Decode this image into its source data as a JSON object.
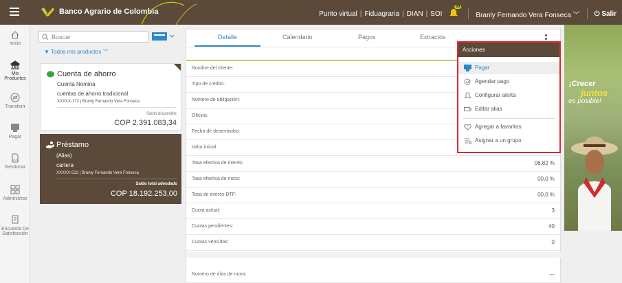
{
  "header": {
    "brand": "Banco Agrario de Colombia",
    "links": [
      "Punto virtual",
      "Fiduagraria",
      "DIAN",
      "SOI"
    ],
    "notification_count": "99",
    "user_name": "Branly Fernando Vera Fonseca",
    "logout_label": "Salir",
    "brand_color": "#5b4a3a"
  },
  "nav": [
    {
      "label": "Inicio",
      "icon": "home-icon"
    },
    {
      "label": "Mis Productos",
      "icon": "bank-icon"
    },
    {
      "label": "Transferir",
      "icon": "transfer-icon"
    },
    {
      "label": "Pagar",
      "icon": "pay-icon"
    },
    {
      "label": "Gestionar",
      "icon": "manage-icon"
    },
    {
      "label": "Administrar",
      "icon": "grid-icon"
    },
    {
      "label": "Encuesta De Satisfacción",
      "icon": "survey-icon"
    }
  ],
  "search": {
    "placeholder": "Buscar"
  },
  "filter_label": "Todos mis productos",
  "products": [
    {
      "title": "Cuenta de ahorro",
      "subtitle": "Cuenta Nomina",
      "description": "cuentas de ahorro tradicional",
      "detail": "XXXXX-172 | Branly Fernando Vera Fonseca",
      "balance_label": "Saldo disponible",
      "balance": "COP 2.391.083,34"
    },
    {
      "title": "Préstamo",
      "subtitle": "(Alias)",
      "description": "cartera",
      "detail": "XXXXX-512 | Branly Fernando Vera Fonseca",
      "balance_label": "Saldo total adeudado",
      "balance": "COP 18.192.253,00"
    }
  ],
  "tabs": [
    "Detalle",
    "Calendario",
    "Pagos",
    "Extractos"
  ],
  "active_tab": "Detalle",
  "details": [
    {
      "label": "Nombre del cliente:",
      "value": ""
    },
    {
      "label": "Tipo de crédito:",
      "value": ""
    },
    {
      "label": "Número de obligación:",
      "value": ""
    },
    {
      "label": "Oficina:",
      "value": ""
    },
    {
      "label": "Fecha de desembolso:",
      "value": ""
    },
    {
      "label": "Valor inicial:",
      "value": ""
    },
    {
      "label": "Tasa efectiva de interés:",
      "value": "06,82 %"
    },
    {
      "label": "Tasa efectiva de mora:",
      "value": "00,0 %"
    },
    {
      "label": "Tasa de interés DTF:",
      "value": "00,0 %"
    },
    {
      "label": "Cuota actual:",
      "value": "3"
    },
    {
      "label": "Cuotas pendientes:",
      "value": "40"
    },
    {
      "label": "Cuotas vencidas:",
      "value": "0"
    },
    {
      "label": "Número de días de mora:",
      "value": "---"
    }
  ],
  "actions_menu": {
    "title": "Acciones",
    "items": [
      {
        "label": "Pagar",
        "icon": "pay-icon"
      },
      {
        "label": "Agendar pago",
        "icon": "schedule-icon"
      },
      {
        "label": "Configurar alerta",
        "icon": "bell-icon"
      },
      {
        "label": "Editar alias",
        "icon": "edit-icon"
      },
      {
        "label": "Agregar a favoritos",
        "icon": "heart-icon"
      },
      {
        "label": "Asignar a un grupo",
        "icon": "group-icon"
      }
    ]
  },
  "banner": {
    "line1": "¡Crecer",
    "line2": "juntos",
    "line3": "es posible!"
  }
}
